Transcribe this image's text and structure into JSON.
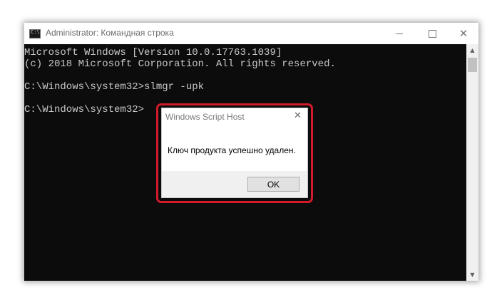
{
  "window": {
    "title": "Administrator: Командная строка",
    "icon": "cmd-icon"
  },
  "console": {
    "lines": [
      "Microsoft Windows [Version 10.0.17763.1039]",
      "(c) 2018 Microsoft Corporation. All rights reserved.",
      "",
      "C:\\Windows\\system32>slmgr -upk",
      "",
      "C:\\Windows\\system32>"
    ]
  },
  "dialog": {
    "title": "Windows Script Host",
    "message": "Ключ продукта успешно удален.",
    "ok_label": "OK"
  },
  "colors": {
    "console_bg": "#0c0c0c",
    "console_text": "#c8c8c8",
    "highlight": "#d11a2a"
  }
}
